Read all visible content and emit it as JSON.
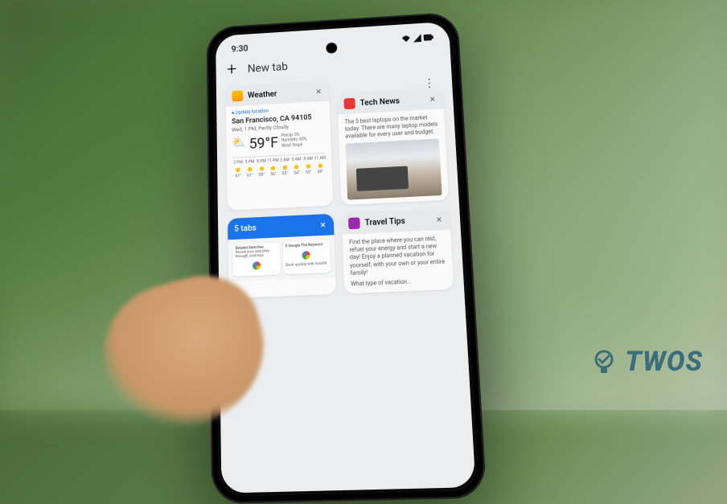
{
  "status_bar": {
    "time": "9:30"
  },
  "header": {
    "new_tab_label": "New tab"
  },
  "overflow_menu": "⋮",
  "cards": {
    "weather": {
      "title": "Weather",
      "close": "×",
      "update_location": "● Update location",
      "city": "San Francisco, CA 94105",
      "subtitle": "Wed, 1 PM, Partly Cloudy",
      "temp": "59°F",
      "details": {
        "precip": "Precip: 0%",
        "humidity": "Humidity: 80%",
        "wind": "Wind: 5mph"
      },
      "forecast": [
        {
          "time": "2 PM",
          "hi": "61°"
        },
        {
          "time": "5 PM",
          "hi": "61°"
        },
        {
          "time": "8 PM",
          "hi": "58°"
        },
        {
          "time": "11 PM",
          "hi": "56°"
        },
        {
          "time": "2 AM",
          "hi": "55°"
        },
        {
          "time": "5 AM",
          "hi": "54°"
        },
        {
          "time": "8 AM",
          "hi": "55°"
        },
        {
          "time": "11 AM",
          "hi": "58°"
        }
      ]
    },
    "tech_news": {
      "title": "Tech News",
      "close": "×",
      "body": "The 5 best laptops on the market today. There are many laptop models available for every user and budget."
    },
    "tabs": {
      "title": "5 tabs",
      "close": "×",
      "mini_tabs": [
        {
          "header": "Related Searches",
          "line": "Revisit your searches through Journeys"
        },
        {
          "header": "G Google  The Keyword",
          "line": "Book quickly with Autofill"
        }
      ]
    },
    "travel": {
      "title": "Travel Tips",
      "close": "×",
      "body": "Find the place where you can rest, refuel your energy and start a new day! Enjoy a planned vacation for yourself, with your own or your entire family!",
      "sub": "What type of vacation..."
    }
  },
  "brand": {
    "text": "TWOS"
  }
}
